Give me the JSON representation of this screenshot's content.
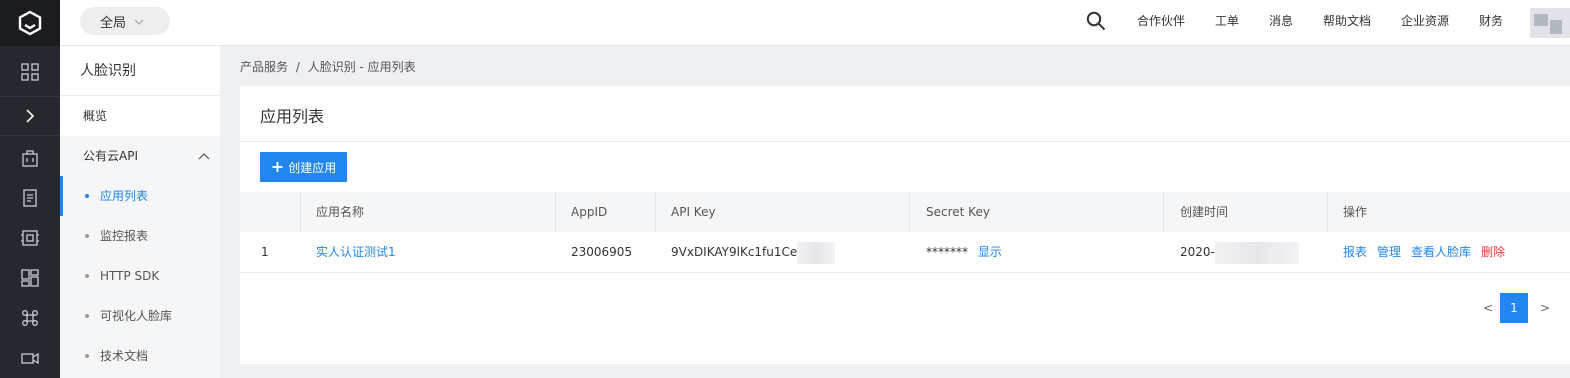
{
  "topbar": {
    "scope": "全局",
    "nav": [
      "合作伙伴",
      "工单",
      "消息",
      "帮助文档",
      "企业资源",
      "财务"
    ]
  },
  "sidebar": {
    "title": "人脸识别",
    "overview": "概览",
    "group": "公有云API",
    "items": [
      {
        "label": "应用列表"
      },
      {
        "label": "监控报表"
      },
      {
        "label": "HTTP SDK"
      },
      {
        "label": "可视化人脸库"
      },
      {
        "label": "技术文档"
      }
    ]
  },
  "breadcrumb": {
    "root": "产品服务",
    "sep": "/",
    "current": "人脸识别 - 应用列表"
  },
  "panel": {
    "title": "应用列表",
    "create_label": "创建应用"
  },
  "table": {
    "headers": [
      "应用名称",
      "AppID",
      "API Key",
      "Secret Key",
      "创建时间",
      "操作"
    ],
    "rows": [
      {
        "index": "1",
        "name": "实人认证测试1",
        "appid": "23006905",
        "api_key": "9VxDIKAY9lKc1fu1Ce",
        "secret_mask": "*******",
        "secret_show": "显示",
        "created": "2020-",
        "actions": [
          "报表",
          "管理",
          "查看人脸库",
          "删除"
        ]
      }
    ]
  },
  "pagination": {
    "prev": "<",
    "current": "1",
    "next": ">"
  },
  "colors": {
    "accent": "#2186f0",
    "danger": "#e53c3c",
    "rail": "#26282d"
  }
}
